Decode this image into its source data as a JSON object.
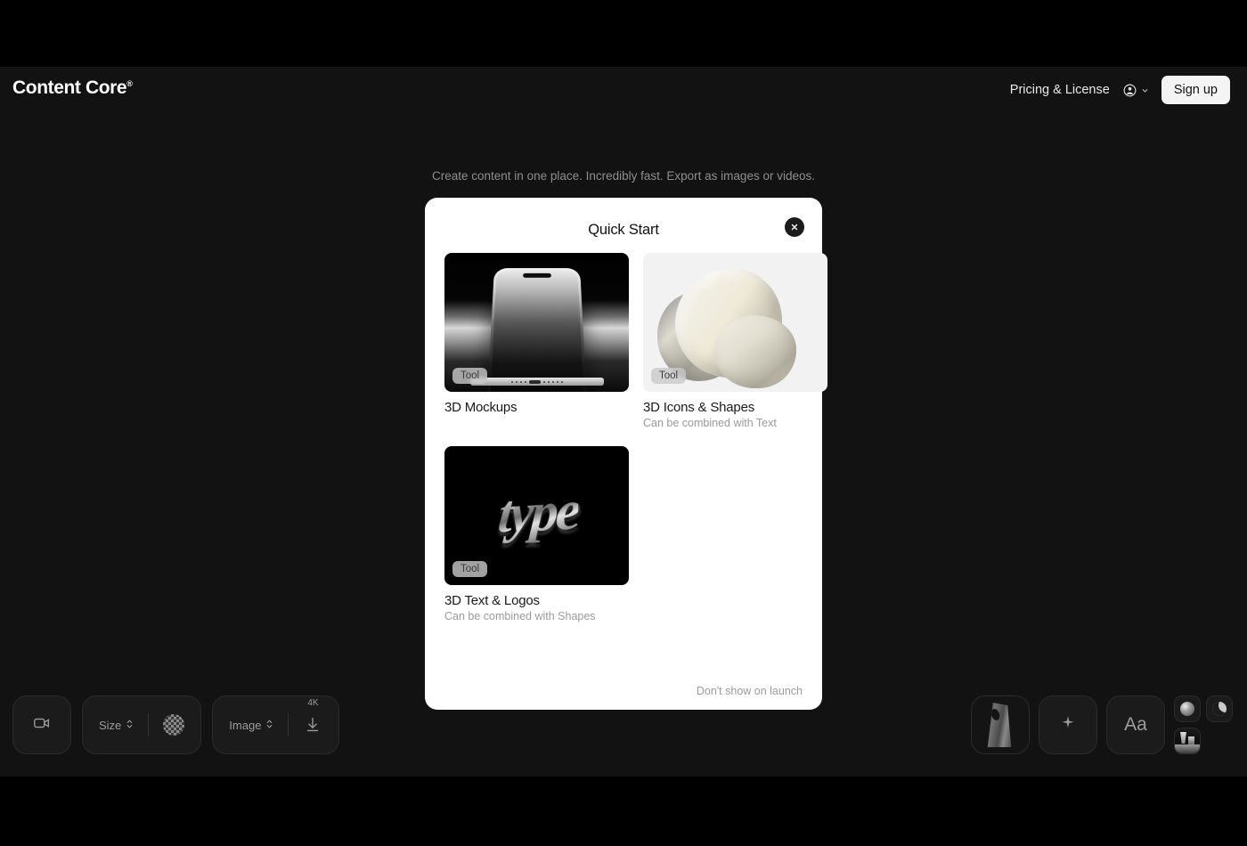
{
  "colors": {
    "page_black": "#000000",
    "app_background": "#121212",
    "modal_background": "#ffffff",
    "accent_button": "#f4f4f4",
    "muted_text": "#9b9b9b"
  },
  "header": {
    "logo_text": "Content Core",
    "logo_mark": "®",
    "pricing_link": "Pricing & License",
    "account_icon": "user-circle-icon",
    "account_chevron": "chevron-down-icon",
    "signup_label": "Sign up"
  },
  "tagline": "Create content in one place. Incredibly fast. Export as images or videos.",
  "modal": {
    "title": "Quick Start",
    "close_icon": "close-icon",
    "footer_link": "Don't show on launch",
    "cards": [
      {
        "title": "3D Mockups",
        "subtitle": "",
        "badge": "Tool",
        "art": "phone-mockup"
      },
      {
        "title": "3D Icons & Shapes",
        "subtitle": "Can be combined with Text",
        "badge": "Tool",
        "art": "blob-shape"
      },
      {
        "title": "3D Text & Logos",
        "subtitle": "Can be combined with Shapes",
        "badge": "Tool",
        "art": "type-lettering",
        "art_word": "type"
      }
    ]
  },
  "toolbar_left": {
    "video_icon": "video-camera-icon",
    "size_label": "Size",
    "size_chevron": "chevron-updown-icon",
    "pattern_icon": "checker-pattern-icon",
    "image_label": "Image",
    "image_chevron": "chevron-updown-icon",
    "export_badge": "4K",
    "export_icon": "download-icon"
  },
  "toolbar_right": {
    "object_tile_icon": "3d-object-thumbnail",
    "effects_icon": "sparkle-icon",
    "text_label": "Aa",
    "material_icon": "sphere-material-icon",
    "lighting_icon": "moon-lighting-icon",
    "scene_icon": "scene-thumbnail-icon"
  }
}
